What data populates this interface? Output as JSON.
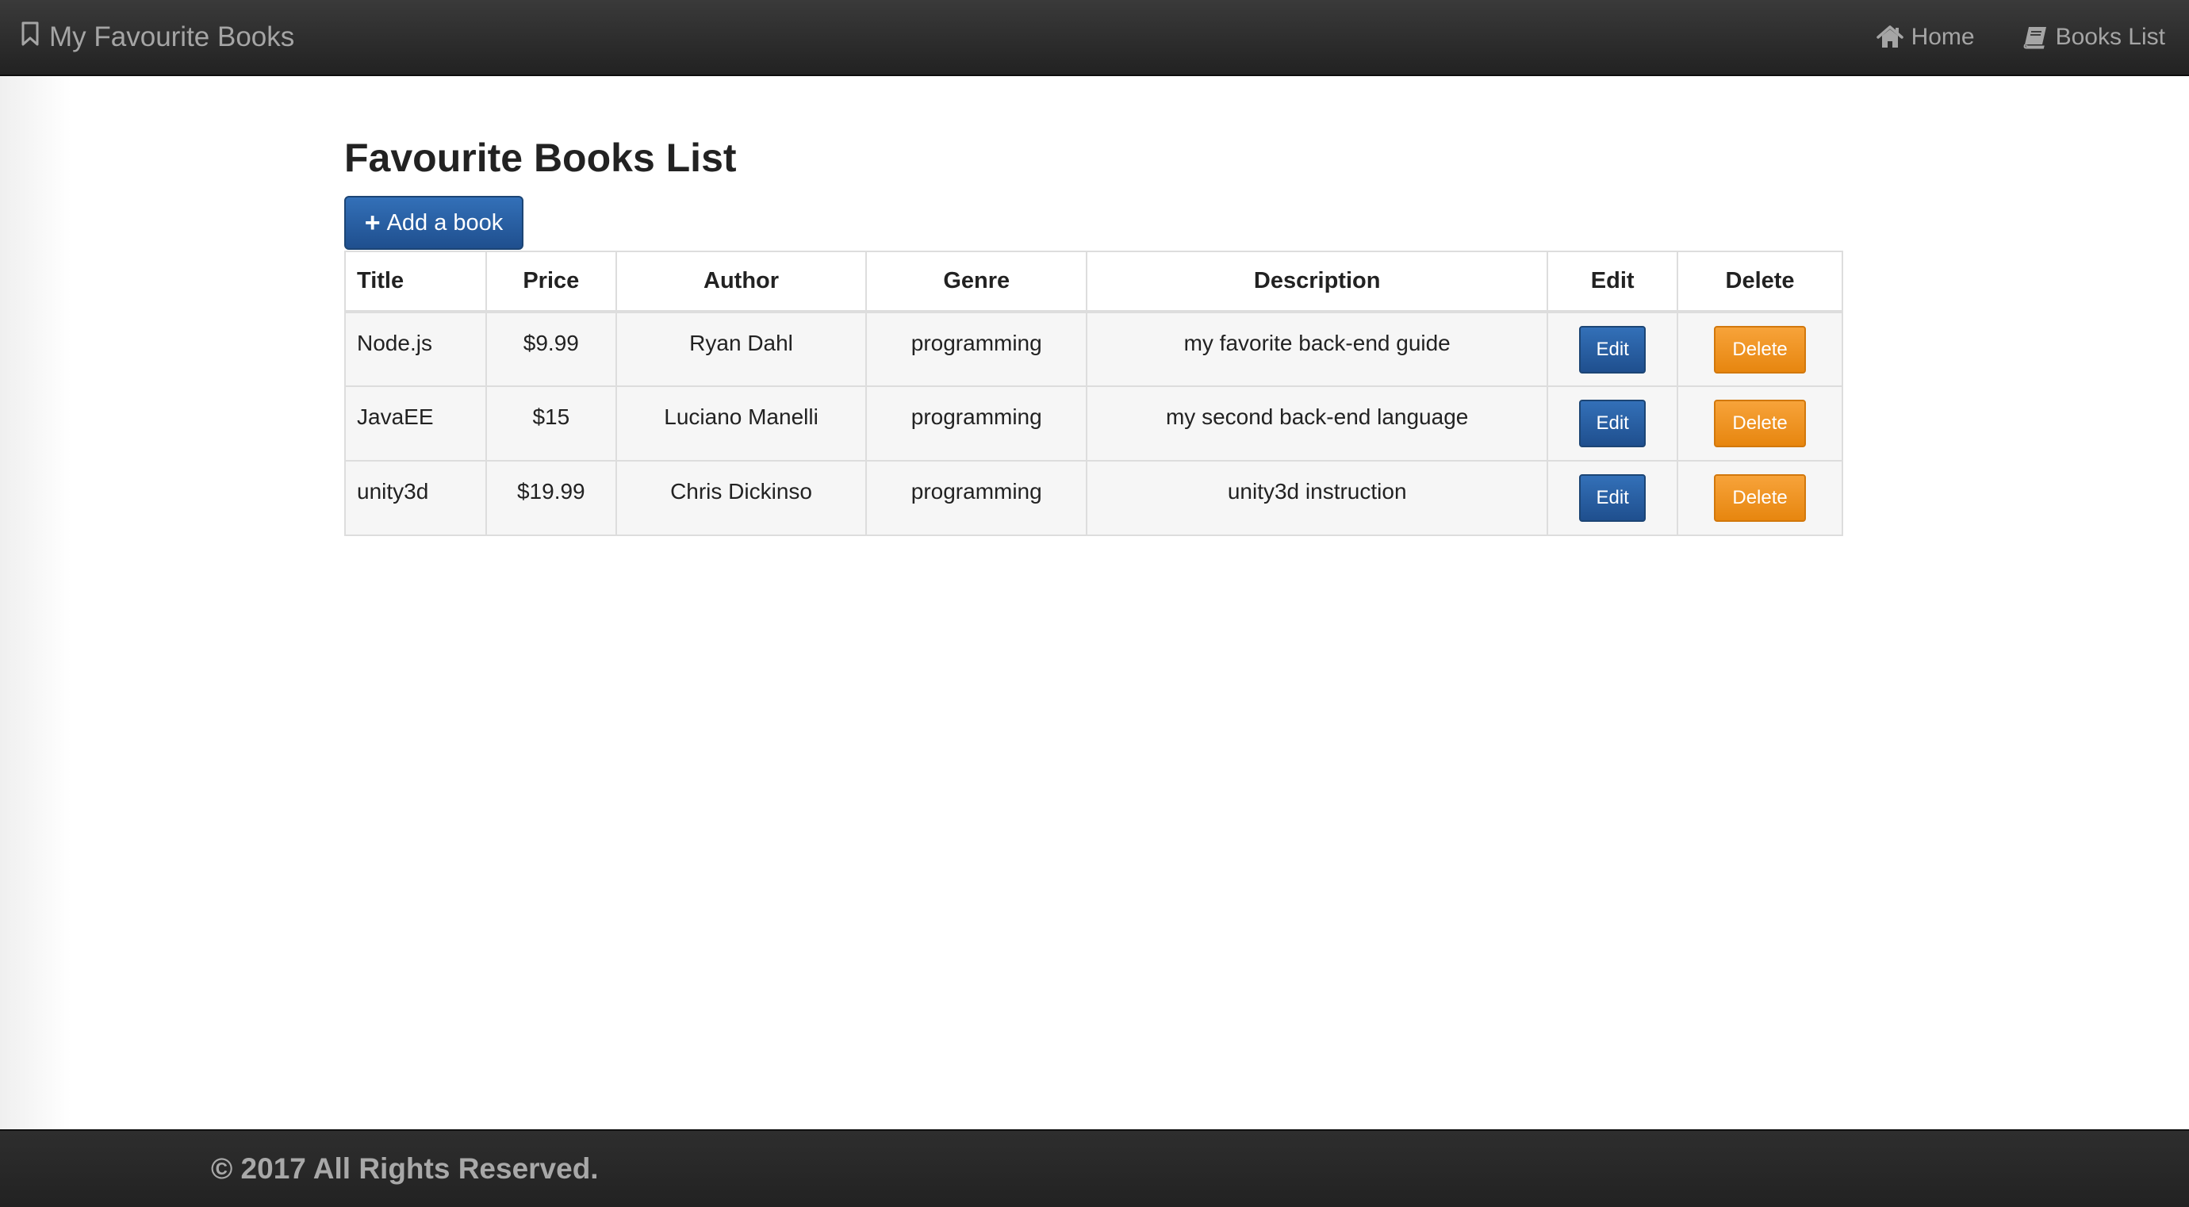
{
  "navbar": {
    "brand": "My Favourite Books",
    "brand_icon": "bookmark-icon",
    "links": [
      {
        "label": "Home",
        "icon": "home-icon"
      },
      {
        "label": "Books List",
        "icon": "book-icon"
      }
    ]
  },
  "main": {
    "title": "Favourite Books List",
    "add_button": {
      "label": "Add a book",
      "icon": "plus-icon"
    },
    "table": {
      "headers": [
        "Title",
        "Price",
        "Author",
        "Genre",
        "Description",
        "Edit",
        "Delete"
      ],
      "rows": [
        {
          "title": "Node.js",
          "price": "$9.99",
          "author": "Ryan Dahl",
          "genre": "programming",
          "description": "my favorite back-end guide",
          "edit": "Edit",
          "delete": "Delete"
        },
        {
          "title": "JavaEE",
          "price": "$15",
          "author": "Luciano Manelli",
          "genre": "programming",
          "description": "my second back-end language",
          "edit": "Edit",
          "delete": "Delete"
        },
        {
          "title": "unity3d",
          "price": "$19.99",
          "author": "Chris Dickinso",
          "genre": "programming",
          "description": "unity3d instruction",
          "edit": "Edit",
          "delete": "Delete"
        }
      ]
    }
  },
  "footer": {
    "text": "© 2017 All Rights Reserved."
  },
  "colors": {
    "navbar_bg": "#222222",
    "primary_button": "#2a5f9e",
    "danger_button": "#ee9623",
    "footer_bg": "#262626"
  }
}
